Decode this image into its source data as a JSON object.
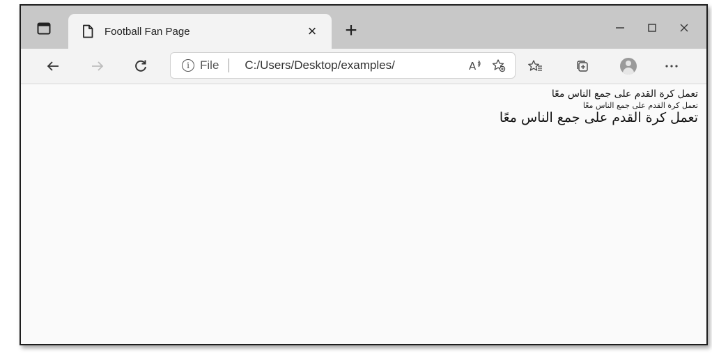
{
  "browser": {
    "tab": {
      "title": "Football Fan Page",
      "close_icon": "close-icon",
      "page_icon": "document-icon"
    },
    "new_tab_label": "+",
    "window_controls": [
      "minimize-icon",
      "maximize-icon",
      "close-icon"
    ],
    "nav": {
      "back_icon": "back-arrow-icon",
      "forward_icon": "forward-arrow-icon",
      "refresh_icon": "refresh-icon"
    },
    "address": {
      "info_glyph": "i",
      "scheme_label": "File",
      "url": "C:/Users/Desktop/examples/"
    },
    "toolbar_icons": [
      "read-aloud-icon",
      "add-favorite-icon",
      "favorites-icon",
      "collections-icon",
      "profile-icon",
      "more-icon"
    ]
  },
  "page": {
    "lines": [
      "تعمل كرة القدم على جمع الناس معًا",
      "تعمل كرة القدم على جمع الناس معًا",
      "تعمل كرة القدم على جمع الناس معًا"
    ]
  }
}
